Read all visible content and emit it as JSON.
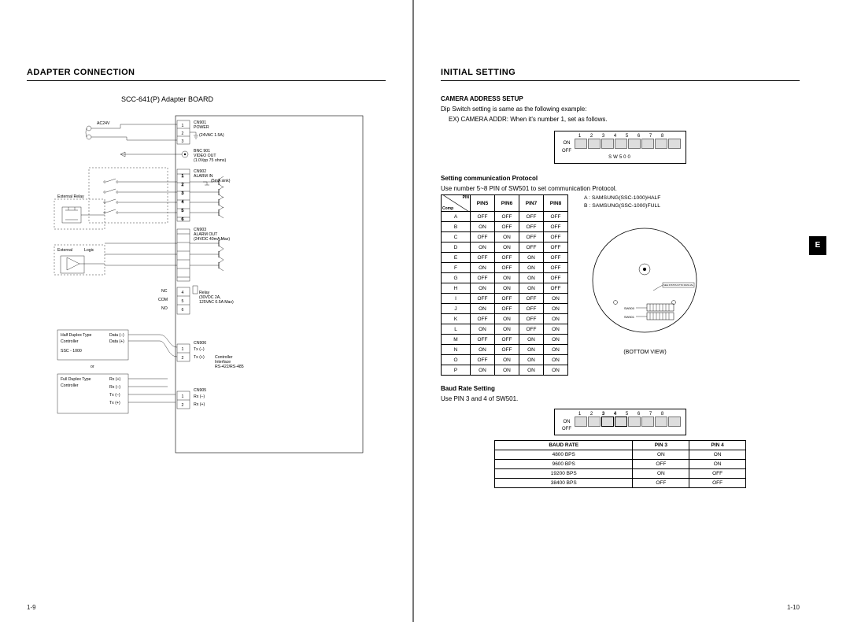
{
  "page_left": {
    "heading": "ADAPTER CONNECTION",
    "caption": "SCC-641(P) Adapter BOARD",
    "page_num": "1-9",
    "schematic": {
      "cn901_title": "CN901",
      "cn901_sub1": "POWER",
      "cn901_sub2": "(24VAC 1.5A)",
      "ac24v": "AC24V",
      "bnc_title": "BNC 901",
      "bnc_sub1": "VIDEO OUT",
      "bnc_sub2": "(1.0Vpp 75 ohms)",
      "cn902_title": "CN902",
      "cn902_sub1": "ALARM  IN",
      "cn902_sub2": "(5mA sink)",
      "ext_relay": "External   Relay",
      "cn903_title": "CN903",
      "cn903_sub1": "ALARM OUT",
      "cn903_sub2": "(24VDC 40mA Max)",
      "ext_logic1": "External",
      "ext_logic2": "Logic",
      "nc": "NC",
      "com": "COM",
      "no": "NO",
      "relay_title": "Relay",
      "relay_sub1": "(30VDC 2A,",
      "relay_sub2": "125VAC 0.5A Max)",
      "half_title": "Half Duplex Type",
      "half_sub": "Controller",
      "half_ssc": "SSC - 1000",
      "half_dm": "Data (–)",
      "half_dp": "Data (+)",
      "or": "or",
      "full_title": "Full Duplex Type",
      "full_sub": "Controller",
      "rxp": "Rx (+)",
      "rxm": "Rx (–)",
      "txm": "Tx (–)",
      "txp": "Tx (+)",
      "cn906": "CN906",
      "cn906_ctrl1": "Controller",
      "cn906_ctrl2": "Interface",
      "cn906_ctrl3": "RS-422/RS-485",
      "cn905": "CN905",
      "pin1": "1",
      "pin2": "2",
      "pin3": "3",
      "pin4": "4",
      "pin5": "5",
      "pin6": "6"
    }
  },
  "page_right": {
    "heading": "INITIAL SETTING",
    "page_num": "1-10",
    "tab": "E",
    "cam_addr": {
      "title": "CAMERA ADDRESS SETUP",
      "line1": "Dip Switch setting is same as the following example:",
      "line2": "EX) CAMERA ADDR: When it's number 1, set as follows.",
      "sw_name": "SW500",
      "on": "ON",
      "off": "OFF",
      "nums": [
        "1",
        "2",
        "3",
        "4",
        "5",
        "6",
        "7",
        "8"
      ]
    },
    "protocol": {
      "title": "Setting communication Protocol",
      "line1": "Use number 5~8 PIN of SW501 to set communication Protocol.",
      "a_label": "A : SAMSUNG(SSC-1000)HALF",
      "b_label": "B : SAMSUNG(SSC-1000)FULL",
      "corner_top": "PIN",
      "corner_bottom": "Comp",
      "cols": [
        "PIN5",
        "PIN6",
        "PIN7",
        "PIN8"
      ],
      "rows": [
        {
          "k": "A",
          "v": [
            "OFF",
            "OFF",
            "OFF",
            "OFF"
          ]
        },
        {
          "k": "B",
          "v": [
            "ON",
            "OFF",
            "OFF",
            "OFF"
          ]
        },
        {
          "k": "C",
          "v": [
            "OFF",
            "ON",
            "OFF",
            "OFF"
          ]
        },
        {
          "k": "D",
          "v": [
            "ON",
            "ON",
            "OFF",
            "OFF"
          ]
        },
        {
          "k": "E",
          "v": [
            "OFF",
            "OFF",
            "ON",
            "OFF"
          ]
        },
        {
          "k": "F",
          "v": [
            "ON",
            "OFF",
            "ON",
            "OFF"
          ]
        },
        {
          "k": "G",
          "v": [
            "OFF",
            "ON",
            "ON",
            "OFF"
          ]
        },
        {
          "k": "H",
          "v": [
            "ON",
            "ON",
            "ON",
            "OFF"
          ]
        },
        {
          "k": "I",
          "v": [
            "OFF",
            "OFF",
            "OFF",
            "ON"
          ]
        },
        {
          "k": "J",
          "v": [
            "ON",
            "OFF",
            "OFF",
            "ON"
          ]
        },
        {
          "k": "K",
          "v": [
            "OFF",
            "ON",
            "OFF",
            "ON"
          ]
        },
        {
          "k": "L",
          "v": [
            "ON",
            "ON",
            "OFF",
            "ON"
          ]
        },
        {
          "k": "M",
          "v": [
            "OFF",
            "OFF",
            "ON",
            "ON"
          ]
        },
        {
          "k": "N",
          "v": [
            "ON",
            "OFF",
            "ON",
            "ON"
          ]
        },
        {
          "k": "O",
          "v": [
            "OFF",
            "ON",
            "ON",
            "ON"
          ]
        },
        {
          "k": "P",
          "v": [
            "ON",
            "ON",
            "ON",
            "ON"
          ]
        }
      ]
    },
    "bottom_view": {
      "caption": "(BOTTOM VIEW)",
      "sw500": "SW500",
      "sw501": "SW501",
      "manual": "SEE INSTRUCTIN MANUAL"
    },
    "baud": {
      "title": "Baud Rate Setting",
      "line1": "Use PIN 3 and 4 of SW501.",
      "dip": {
        "nums": [
          "1",
          "2",
          "3",
          "4",
          "5",
          "6",
          "7",
          "8"
        ],
        "on": "ON",
        "off": "OFF"
      },
      "cols": [
        "BAUD RATE",
        "PIN 3",
        "PIN 4"
      ],
      "rows": [
        {
          "r": "4800 BPS",
          "p3": "ON",
          "p4": "ON"
        },
        {
          "r": "9600 BPS",
          "p3": "OFF",
          "p4": "ON"
        },
        {
          "r": "19200 BPS",
          "p3": "ON",
          "p4": "OFF"
        },
        {
          "r": "38400 BPS",
          "p3": "OFF",
          "p4": "OFF"
        }
      ]
    }
  }
}
